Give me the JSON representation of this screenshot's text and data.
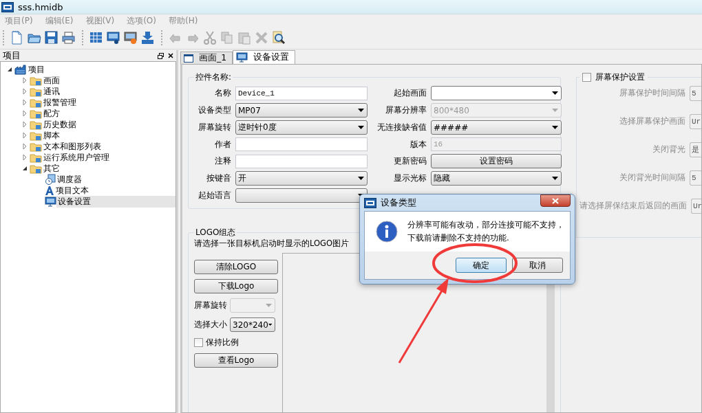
{
  "window": {
    "title": "sss.hmidb"
  },
  "menu": [
    {
      "label": "项目(P)"
    },
    {
      "label": "编辑(E)"
    },
    {
      "label": "视图(V)"
    },
    {
      "label": "选项(O)"
    },
    {
      "label": "帮助(H)"
    }
  ],
  "toolbar": [
    [
      {
        "kind": "new",
        "disabled": false
      },
      {
        "kind": "open",
        "disabled": false
      },
      {
        "kind": "save",
        "disabled": false
      },
      {
        "kind": "print",
        "disabled": false
      }
    ],
    [
      {
        "kind": "grid",
        "disabled": false
      },
      {
        "kind": "monitor",
        "disabled": false
      },
      {
        "kind": "simulate",
        "disabled": false
      },
      {
        "kind": "download",
        "disabled": false
      }
    ],
    [
      {
        "kind": "undo",
        "disabled": true
      },
      {
        "kind": "redo",
        "disabled": true
      },
      {
        "kind": "cut",
        "disabled": true
      },
      {
        "kind": "copy",
        "disabled": true
      },
      {
        "kind": "paste",
        "disabled": true
      },
      {
        "kind": "delete",
        "disabled": true
      },
      {
        "kind": "find",
        "disabled": false
      }
    ]
  ],
  "project_panel": {
    "title": "项目",
    "tree": [
      {
        "label": "项目",
        "kind": "project",
        "expanded": true,
        "selected": false,
        "children": [
          {
            "label": "画面",
            "kind": "folder",
            "expanded": false,
            "selected": false
          },
          {
            "label": "通讯",
            "kind": "folder",
            "expanded": false,
            "selected": false
          },
          {
            "label": "报警管理",
            "kind": "folder",
            "expanded": false,
            "selected": false
          },
          {
            "label": "配方",
            "kind": "folder",
            "expanded": false,
            "selected": false
          },
          {
            "label": "历史数据",
            "kind": "folder",
            "expanded": false,
            "selected": false
          },
          {
            "label": "脚本",
            "kind": "folder",
            "expanded": false,
            "selected": false
          },
          {
            "label": "文本和图形列表",
            "kind": "folder",
            "expanded": false,
            "selected": false
          },
          {
            "label": "运行系统用户管理",
            "kind": "folder",
            "expanded": false,
            "selected": false
          },
          {
            "label": "其它",
            "kind": "folder",
            "expanded": true,
            "selected": false,
            "children": [
              {
                "label": "调度器",
                "kind": "scheduler",
                "selected": false
              },
              {
                "label": "项目文本",
                "kind": "text",
                "selected": false
              },
              {
                "label": "设备设置",
                "kind": "device",
                "selected": true
              }
            ]
          }
        ]
      }
    ]
  },
  "tabs": [
    {
      "label": "画面_1",
      "kind": "screen",
      "selected": false
    },
    {
      "label": "设备设置",
      "kind": "device",
      "selected": true
    }
  ],
  "device_group": {
    "title": "控件名称:",
    "fields": [
      {
        "label": "名称",
        "kind": "text",
        "value": "Device_1",
        "disabled": false
      },
      {
        "label": "起始画面",
        "kind": "editcombo",
        "disabled": false
      },
      {
        "label": "设备类型",
        "kind": "combo",
        "value": "MP07",
        "disabled": false
      },
      {
        "label": "屏幕分辨率",
        "kind": "combo",
        "value": "800*480",
        "disabled": true
      },
      {
        "label": "屏幕旋转",
        "kind": "combo",
        "value": "逆时针0度",
        "disabled": false
      },
      {
        "label": "无连接缺省值",
        "kind": "combo",
        "value": "#####",
        "disabled": false
      },
      {
        "label": "作者",
        "kind": "text",
        "disabled": false
      },
      {
        "label": "版本",
        "kind": "text",
        "value": "16",
        "disabled": true
      },
      {
        "label": "注释",
        "kind": "text",
        "disabled": false
      },
      {
        "label": "更新密码",
        "kind": "button",
        "value": "设置密码",
        "disabled": false
      },
      {
        "label": "按键音",
        "kind": "combo",
        "value": "开",
        "disabled": false
      },
      {
        "label": "显示光标",
        "kind": "combo",
        "value": "隐藏",
        "disabled": false
      },
      {
        "label": "起始语言",
        "kind": "combo",
        "disabled": false
      }
    ]
  },
  "logo_group": {
    "title": "LOGO组态",
    "hint": "请选择一张目标机启动时显示的LOGO图片",
    "items": [
      {
        "kind": "button",
        "label": "清除LOGO"
      },
      {
        "kind": "button",
        "label": "下载Logo"
      },
      {
        "kind": "combo",
        "label": "屏幕旋转",
        "disabled": true
      },
      {
        "kind": "combo",
        "label": "选择大小",
        "value": "320*240",
        "disabled": false
      },
      {
        "kind": "checkbox",
        "label": "保持比例",
        "checked": false
      },
      {
        "kind": "button",
        "label": "查看Logo"
      }
    ]
  },
  "screensaver_group": {
    "title": "屏幕保护设置",
    "checked": false,
    "fields": [
      {
        "label": "屏幕保护时间间隔",
        "value": "5"
      },
      {
        "label": "选择屏幕保护画面",
        "value": "Ur"
      },
      {
        "label": "关闭背光",
        "value": "是"
      },
      {
        "label": "关闭背光时间间隔",
        "value": "5"
      },
      {
        "label": "请选择屏保结束后返回的画面",
        "value": "Ur"
      }
    ]
  },
  "dialog": {
    "title": "设备类型",
    "message_lines": [
      "分辨率可能有改动，部分连接可能不支持，",
      "下载前请删除不支持的功能."
    ],
    "buttons": [
      {
        "label": "确定",
        "default": true
      },
      {
        "label": "取消",
        "default": false
      }
    ]
  }
}
